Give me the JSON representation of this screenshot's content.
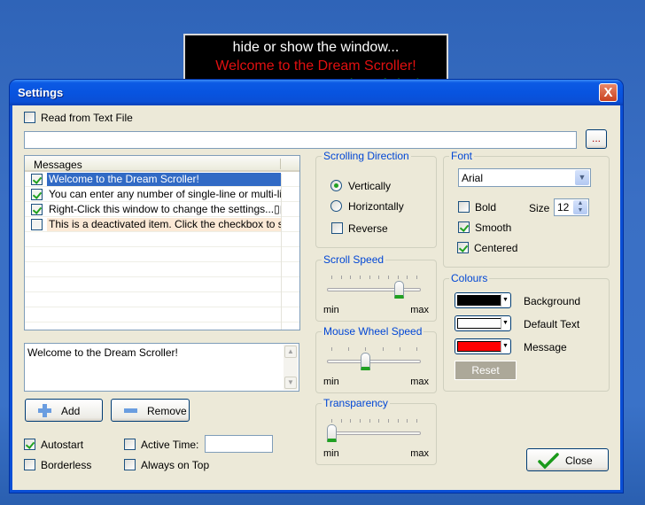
{
  "background_window": {
    "lines": [
      "hide or show the window...",
      "Welcome to the Dream Scroller!",
      "You can enter any number of single"
    ]
  },
  "window": {
    "title": "Settings",
    "close_label": "X"
  },
  "read_from_file": {
    "label": "Read from Text File",
    "checked": false
  },
  "file_path": {
    "value": "",
    "browse_label": "..."
  },
  "messages": {
    "header": "Messages",
    "items": [
      {
        "text": "Welcome to the Dream Scroller!",
        "checked": true,
        "selected": true
      },
      {
        "text": "You can enter any number of single-line or multi-line it...",
        "checked": true
      },
      {
        "text": "Right-Click this window to change the settings...▯▯Left...",
        "checked": true
      },
      {
        "text": "This is a deactivated item. Click the checkbox to sho...",
        "checked": false,
        "deactivated": true
      }
    ]
  },
  "editor": {
    "value": "Welcome to the Dream Scroller!"
  },
  "buttons": {
    "add": "Add",
    "remove": "Remove",
    "close": "Close",
    "reset": "Reset"
  },
  "options": {
    "autostart": {
      "label": "Autostart",
      "checked": true
    },
    "borderless": {
      "label": "Borderless",
      "checked": false
    },
    "active_time": {
      "label": "Active Time:",
      "checked": false,
      "value": ""
    },
    "always_on_top": {
      "label": "Always on Top",
      "checked": false
    }
  },
  "scrolling_direction": {
    "title": "Scrolling Direction",
    "vertically": "Vertically",
    "horizontally": "Horizontally",
    "reverse": "Reverse",
    "selected": "Vertically",
    "reverse_checked": false
  },
  "scroll_speed": {
    "title": "Scroll Speed",
    "min": "min",
    "max": "max",
    "ticks": 10,
    "value_fraction": 0.8
  },
  "mouse_wheel_speed": {
    "title": "Mouse Wheel Speed",
    "min": "min",
    "max": "max",
    "ticks": 6,
    "value_fraction": 0.4
  },
  "transparency": {
    "title": "Transparency",
    "min": "min",
    "max": "max",
    "ticks": 10,
    "value_fraction": 0.0
  },
  "font": {
    "title": "Font",
    "family": "Arial",
    "bold": {
      "label": "Bold",
      "checked": false
    },
    "size_label": "Size",
    "size": "12",
    "smooth": {
      "label": "Smooth",
      "checked": true
    },
    "centered": {
      "label": "Centered",
      "checked": true
    }
  },
  "colours": {
    "title": "Colours",
    "items": [
      {
        "label": "Background",
        "color": "#000000"
      },
      {
        "label": "Default Text",
        "color": "#ffffff"
      },
      {
        "label": "Message",
        "color": "#ff0000"
      }
    ]
  }
}
